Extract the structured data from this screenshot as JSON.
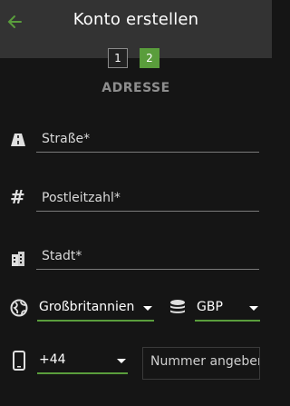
{
  "header": {
    "title": "Konto erstellen",
    "back_icon": "arrow-left-icon"
  },
  "steps": [
    {
      "label": "1",
      "state": "done"
    },
    {
      "label": "2",
      "state": "active"
    }
  ],
  "section": {
    "title": "ADRESSE"
  },
  "form": {
    "street": {
      "placeholder": "Straße*",
      "icon": "road-icon"
    },
    "postal": {
      "placeholder": "Postleitzahl*",
      "icon": "hash-icon"
    },
    "city": {
      "placeholder": "Stadt*",
      "icon": "building-icon"
    },
    "country": {
      "value": "Großbritannien",
      "icon": "globe-icon"
    },
    "currency": {
      "value": "GBP",
      "icon": "coins-icon"
    },
    "dial_code": {
      "value": "+44",
      "icon": "phone-icon"
    },
    "phone": {
      "placeholder": "Nummer angeben"
    }
  },
  "colors": {
    "accent": "#5a9d3c",
    "header_bg": "#333333",
    "page_bg": "#151515"
  }
}
